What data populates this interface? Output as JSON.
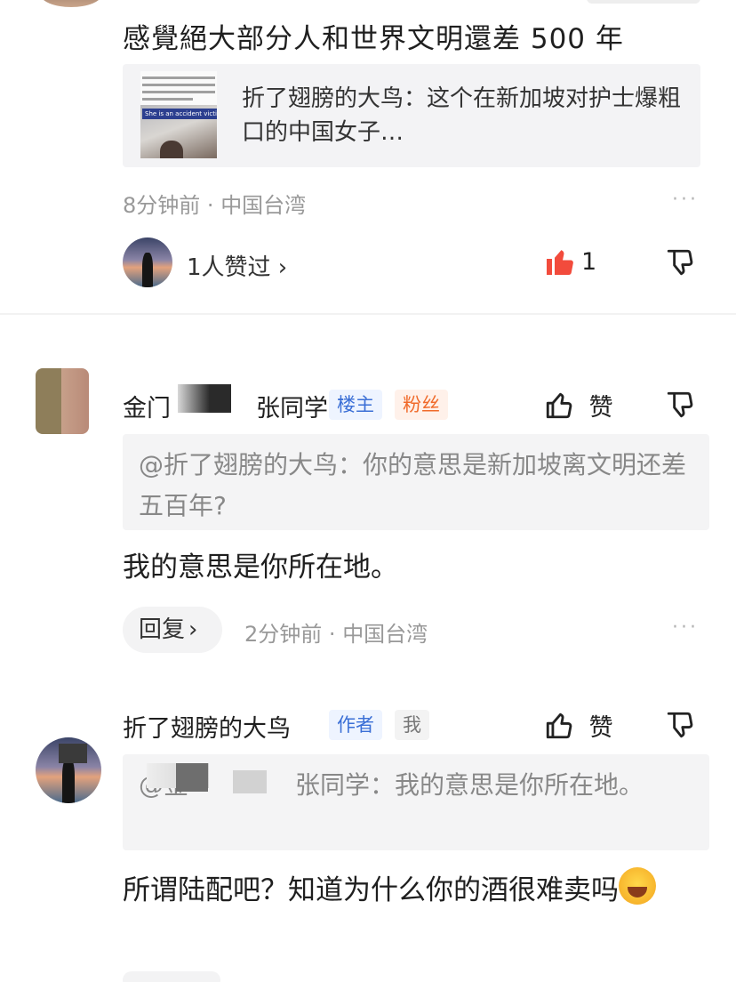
{
  "post": {
    "text": "感覺絕大部分人和世界文明還差 500 年",
    "link_card": {
      "title": "折了翅膀的大鸟：这个在新加坡对护士爆粗口的中国女子…",
      "thumb_caption": "She is an accident victim..."
    },
    "time": "8分钟前",
    "location": "中国台湾",
    "liked_by": "1人赞过 ›",
    "like_count": "1"
  },
  "comments": [
    {
      "name_left": "金门",
      "name_right": "张同学",
      "badges": [
        "楼主",
        "粉丝"
      ],
      "like_label": "赞",
      "quote": "@折了翅膀的大鸟：你的意思是新加坡离文明还差五百年?",
      "text": "我的意思是你所在地。",
      "reply_label": "回复",
      "time": "2分钟前",
      "location": "中国台湾"
    },
    {
      "name": "折了翅膀的大鸟",
      "badges": [
        "作者",
        "我"
      ],
      "like_label": "赞",
      "quote_prefix": "@金",
      "quote_tail": "张同学：我的意思是你所在地。",
      "text": "所谓陆配吧？知道为什么你的酒很难卖吗"
    }
  ],
  "colors": {
    "like_red": "#f24b3c",
    "owner_badge": "#3b6fd6",
    "fans_badge": "#f06a2a",
    "meta_gray": "#999999"
  },
  "icons": [
    "thumb-up-icon",
    "thumb-down-icon",
    "more-icon",
    "laughing-crying-emoji"
  ]
}
